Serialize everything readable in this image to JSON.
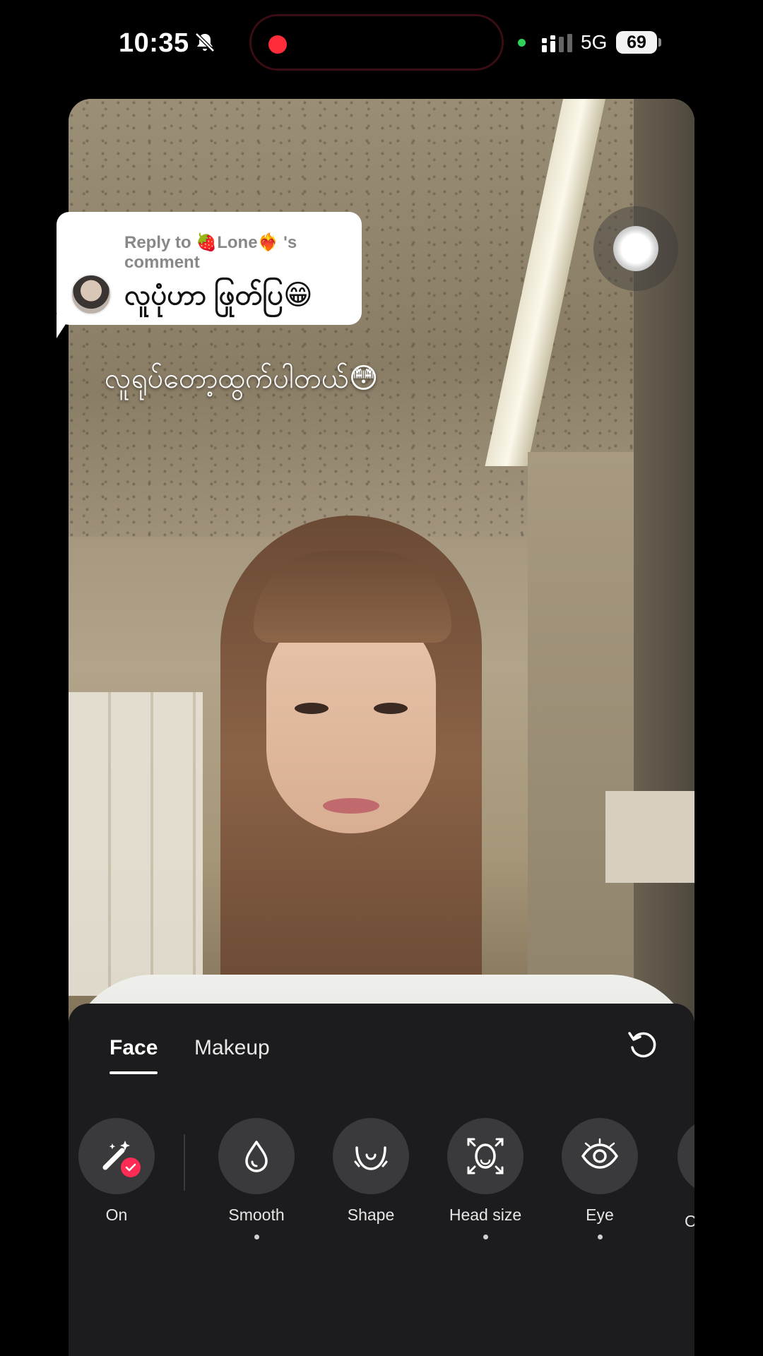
{
  "status_bar": {
    "time": "10:35",
    "network": "5G",
    "battery": "69"
  },
  "reply": {
    "meta": "Reply to 🍓Lone❤️‍🔥 's comment",
    "comment": "လူပုံဟာ ဖြုတ်ပြ😁"
  },
  "caption": "လူရုပ်တော့ထွက်ပါတယ်😳",
  "panel": {
    "tabs": [
      {
        "label": "Face",
        "active": true
      },
      {
        "label": "Makeup",
        "active": false
      }
    ],
    "tools": [
      {
        "label": "On",
        "icon": "magic-wand-icon",
        "dot": false
      },
      {
        "label": "Smooth",
        "icon": "droplet-icon",
        "dot": true
      },
      {
        "label": "Shape",
        "icon": "face-shape-icon",
        "dot": false
      },
      {
        "label": "Head size",
        "icon": "head-size-icon",
        "dot": true
      },
      {
        "label": "Eye",
        "icon": "eye-icon",
        "dot": true
      }
    ],
    "partial_tool_label": "C"
  },
  "colors": {
    "accent": "#fe2c55",
    "panel_bg": "#1c1c1e",
    "recording": "#ff2d3a"
  }
}
